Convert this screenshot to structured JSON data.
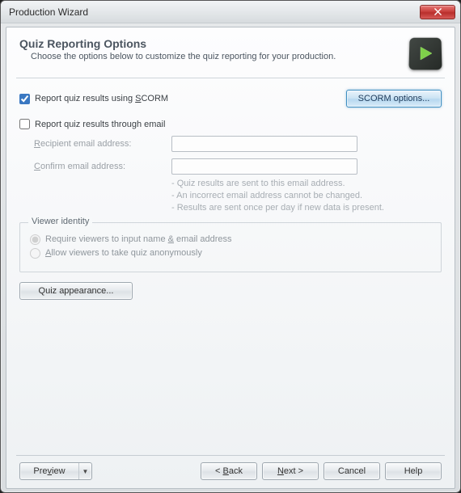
{
  "window": {
    "title": "Production Wizard"
  },
  "header": {
    "heading": "Quiz Reporting Options",
    "sub": "Choose the options below to customize the quiz reporting for your production."
  },
  "scorm": {
    "checkbox_label_pre": "Report quiz results using ",
    "checkbox_label_hot": "S",
    "checkbox_label_post": "CORM",
    "checked": true,
    "options_btn": "SCORM options..."
  },
  "email": {
    "checkbox_label": "Report quiz results through email",
    "checked": false,
    "recipient_label_hot": "R",
    "recipient_label_rest": "ecipient email address:",
    "confirm_label_hot": "C",
    "confirm_label_rest": "onfirm email address:",
    "recipient_value": "",
    "confirm_value": "",
    "hints": [
      "Quiz results are sent to this email address.",
      "An incorrect email address cannot be changed.",
      "Results are sent once per day if new data is present."
    ]
  },
  "viewer": {
    "legend": "Viewer identity",
    "opt1_pre": "Require viewers to input name ",
    "opt1_hot": "&",
    "opt1_post": " email address",
    "opt2_hot": "A",
    "opt2_post": "llow viewers to take quiz anonymously",
    "selected": "require"
  },
  "quiz_appearance_btn": "Quiz appearance...",
  "footer": {
    "preview_hot": "v",
    "preview_pre": "Pre",
    "preview_post": "iew",
    "back_pre": "< ",
    "back_hot": "B",
    "back_post": "ack",
    "next_hot": "N",
    "next_post": "ext >",
    "cancel": "Cancel",
    "help": "Help"
  }
}
